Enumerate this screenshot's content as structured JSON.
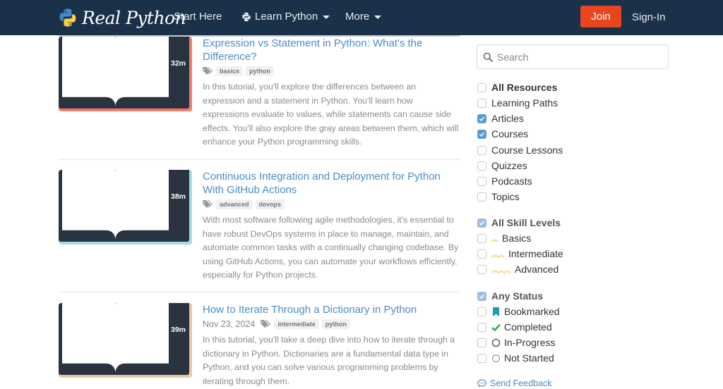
{
  "navbar": {
    "brand": "Real Python",
    "items": [
      {
        "label": "Start Here"
      },
      {
        "label": "Learn Python",
        "icon": "python-icon",
        "dropdown": true
      },
      {
        "label": "More",
        "dropdown": true
      }
    ],
    "join_label": "Join",
    "signin_label": "Sign-In"
  },
  "articles": [
    {
      "title": "Expression vs Statement in Python: What's the Difference?",
      "date": "",
      "tags": [
        "basics",
        "python"
      ],
      "description": "In this tutorial, you'll explore the differences between an expression and a statement in Python. You'll learn how expressions evaluate to values, while statements can cause side effects. You'll also explore the gray areas between them, which will enhance your Python programming skills.",
      "duration": "32m",
      "thumb_color": "#f67a6c"
    },
    {
      "title": "Continuous Integration and Deployment for Python With GitHub Actions",
      "date": "",
      "tags": [
        "advanced",
        "devops"
      ],
      "description": "With most software following agile methodologies, it's essential to have robust DevOps systems in place to manage, maintain, and automate common tasks with a continually changing codebase. By using GitHub Actions, you can automate your workflows efficiently, especially for Python projects.",
      "duration": "38m",
      "thumb_color": "#a3dde2"
    },
    {
      "title": "How to Iterate Through a Dictionary in Python",
      "date": "Nov 23, 2024",
      "tags": [
        "intermediate",
        "python"
      ],
      "description": "In this tutorial, you'll take a deep dive into how to iterate through a dictionary in Python. Dictionaries are a fundamental data type in Python, and you can solve various programming problems by iterating through them.",
      "duration": "39m",
      "thumb_color": "#ecc7a8"
    }
  ],
  "sidebar": {
    "search_placeholder": "Search",
    "resources": [
      {
        "label": "All Resources",
        "checked": false,
        "bold": true
      },
      {
        "label": "Learning Paths",
        "checked": false
      },
      {
        "label": "Articles",
        "checked": true
      },
      {
        "label": "Courses",
        "checked": true
      },
      {
        "label": "Course Lessons",
        "checked": false
      },
      {
        "label": "Quizzes",
        "checked": false
      },
      {
        "label": "Podcasts",
        "checked": false
      },
      {
        "label": "Topics",
        "checked": false
      }
    ],
    "skill_levels": [
      {
        "label": "All Skill Levels",
        "checked": true,
        "bold": true
      },
      {
        "label": "Basics",
        "checked": false,
        "chevrons": "^"
      },
      {
        "label": "Intermediate",
        "checked": false,
        "chevrons": "^^"
      },
      {
        "label": "Advanced",
        "checked": false,
        "chevrons": "^^^"
      }
    ],
    "status": [
      {
        "label": "Any Status",
        "checked": true,
        "bold": true
      },
      {
        "label": "Bookmarked",
        "checked": false,
        "icon": "bookmark-icon"
      },
      {
        "label": "Completed",
        "checked": false,
        "icon": "check-icon"
      },
      {
        "label": "In-Progress",
        "checked": false,
        "icon": "circle-icon"
      },
      {
        "label": "Not Started",
        "checked": false,
        "icon": "circle-outline-icon"
      }
    ],
    "feedback_label": "Send Feedback"
  },
  "colors": {
    "navbar_bg": "#1a3149",
    "join_bg": "#e8461f",
    "link": "#4a8cc9",
    "checkbox_checked": "#5b9bd5",
    "chevron": "#f5b82e",
    "bookmark": "#1b9cb5",
    "completed": "#22a845"
  }
}
